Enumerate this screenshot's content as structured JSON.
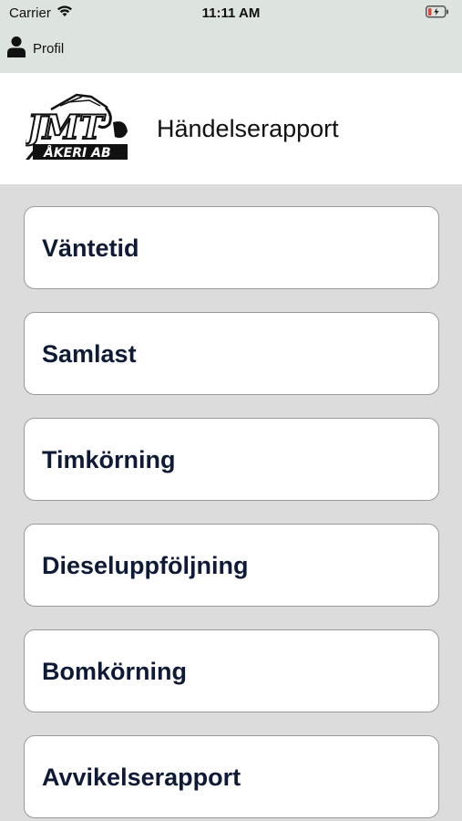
{
  "status_bar": {
    "carrier": "Carrier",
    "time": "11:11 AM"
  },
  "profile": {
    "label": "Profil"
  },
  "header": {
    "logo_text": "JMT ÅKERI AB",
    "title": "Händelserapport"
  },
  "menu": {
    "items": [
      {
        "label": "Väntetid"
      },
      {
        "label": "Samlast"
      },
      {
        "label": "Timkörning"
      },
      {
        "label": "Dieseluppföljning"
      },
      {
        "label": "Bomkörning"
      },
      {
        "label": "Avvikelserapport"
      }
    ]
  },
  "colors": {
    "status_bg": "#dde3de",
    "page_bg": "#dcdcdc",
    "button_text": "#0f1a36",
    "battery_red": "#e0453a"
  },
  "icons": [
    "wifi-icon",
    "battery-icon",
    "person-icon"
  ]
}
